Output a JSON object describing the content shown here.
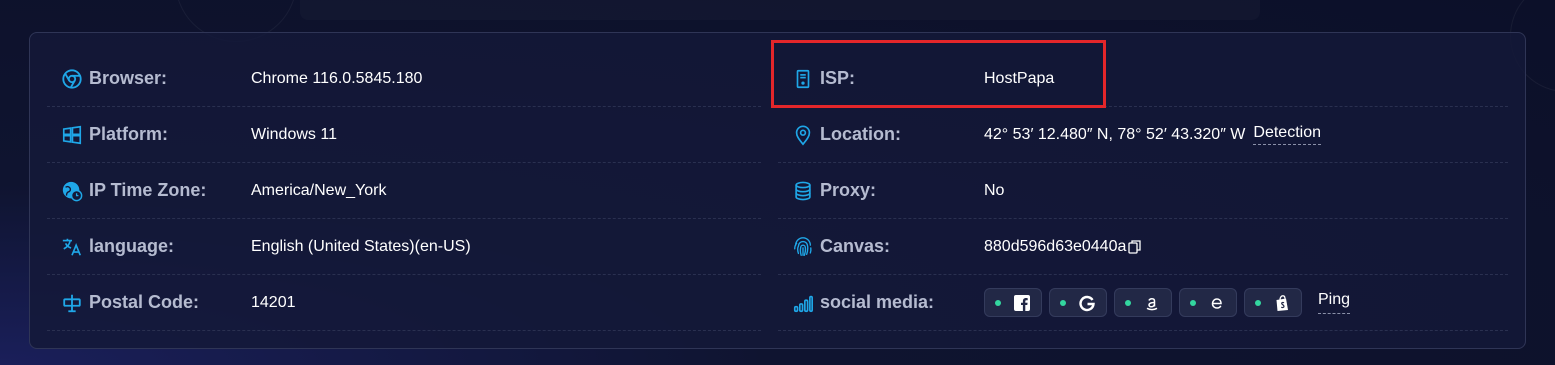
{
  "colors": {
    "accent": "#1fa7e8",
    "label": "#b5bbd0",
    "value": "#ffffff",
    "status_dot": "#33d69f",
    "highlight": "#e3262a"
  },
  "left_rows": [
    {
      "icon": "chrome-icon",
      "label": "Browser:",
      "value": "Chrome 116.0.5845.180"
    },
    {
      "icon": "windows-icon",
      "label": "Platform:",
      "value": "Windows 11"
    },
    {
      "icon": "globe-clock-icon",
      "label": "IP Time Zone:",
      "value": "America/New_York"
    },
    {
      "icon": "translate-icon",
      "label": "language:",
      "value": "English (United States)(en-US)"
    },
    {
      "icon": "mailbox-icon",
      "label": "Postal Code:",
      "value": "14201"
    }
  ],
  "right_rows": {
    "isp": {
      "icon": "server-icon",
      "label": "ISP:",
      "value": "HostPapa"
    },
    "location": {
      "icon": "map-pin-icon",
      "label": "Location:",
      "value": "42° 53′ 12.480″ N, 78° 52′ 43.320″ W",
      "link": "Detection"
    },
    "proxy": {
      "icon": "database-icon",
      "label": "Proxy:",
      "value": "No"
    },
    "canvas": {
      "icon": "fingerprint-icon",
      "label": "Canvas:",
      "value": "880d596d63e0440a",
      "action_icon": "copy-icon"
    },
    "social": {
      "icon": "signal-bars-icon",
      "label": "social media:",
      "services": [
        "facebook-icon",
        "google-icon",
        "amazon-icon",
        "ebay-icon",
        "shopify-icon"
      ],
      "link": "Ping"
    }
  }
}
